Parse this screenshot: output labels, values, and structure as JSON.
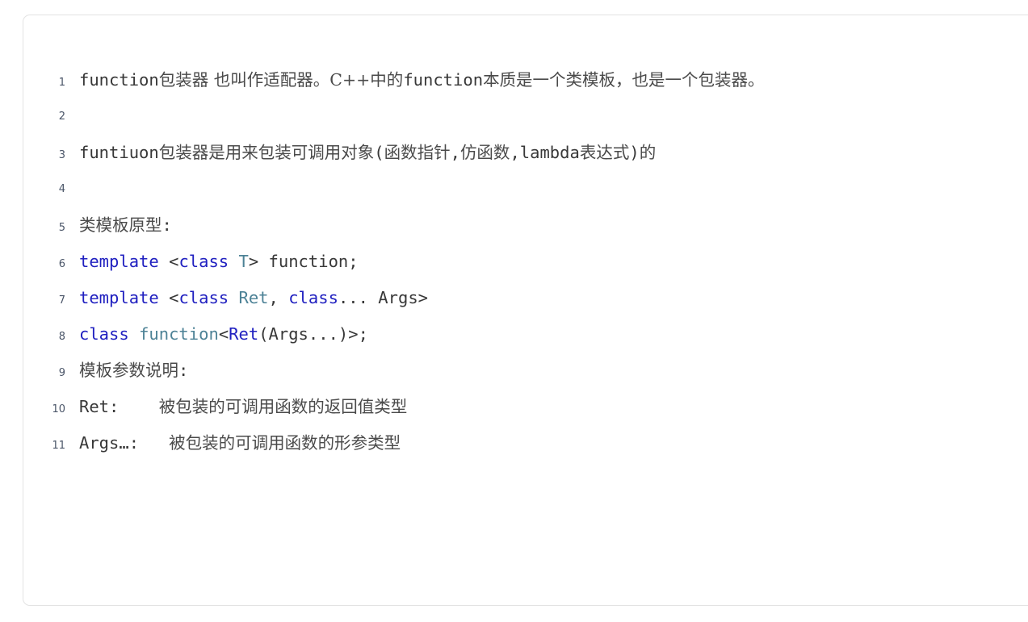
{
  "card": {
    "name": "code-block",
    "border_color": "#e3e3e3",
    "background": "#ffffff",
    "line_number_color": "#4a5568",
    "text_color": "#383838",
    "cjk_text_color": "#4a4a4a",
    "keyword_color": "#2020c0",
    "type_color": "#4d8296"
  },
  "lines": [
    {
      "number": "1",
      "text": "function包装器 也叫作适配器。C++中的function本质是一个类模板，也是一个包装器。",
      "segments": [
        {
          "text": "function",
          "kind": "plain"
        },
        {
          "text": "包装器 也叫作适配器。C++中的",
          "kind": "cjk"
        },
        {
          "text": "function",
          "kind": "plain"
        },
        {
          "text": "本质是一个类模板，也是一个包装器。",
          "kind": "cjk"
        }
      ]
    },
    {
      "number": "2",
      "text": "",
      "segments": []
    },
    {
      "number": "3",
      "text": "funtiuon包装器是用来包装可调用对象(函数指针,仿函数,lambda表达式)的",
      "segments": [
        {
          "text": "funtiuon",
          "kind": "plain"
        },
        {
          "text": "包装器是用来包装可调用对象",
          "kind": "cjk"
        },
        {
          "text": "(",
          "kind": "plain"
        },
        {
          "text": "函数指针",
          "kind": "cjk"
        },
        {
          "text": ",",
          "kind": "plain"
        },
        {
          "text": "仿函数",
          "kind": "cjk"
        },
        {
          "text": ",",
          "kind": "plain"
        },
        {
          "text": "lambda",
          "kind": "plain"
        },
        {
          "text": "表达式",
          "kind": "cjk"
        },
        {
          "text": ")",
          "kind": "plain"
        },
        {
          "text": "的",
          "kind": "cjk"
        }
      ]
    },
    {
      "number": "4",
      "text": "",
      "segments": []
    },
    {
      "number": "5",
      "text": "类模板原型:",
      "segments": [
        {
          "text": "类模板原型",
          "kind": "cjk"
        },
        {
          "text": ":",
          "kind": "plain"
        }
      ]
    },
    {
      "number": "6",
      "text": "template <class T> function;",
      "segments": [
        {
          "text": "template",
          "kind": "keyword"
        },
        {
          "text": " <",
          "kind": "plain"
        },
        {
          "text": "class",
          "kind": "keyword"
        },
        {
          "text": " ",
          "kind": "plain"
        },
        {
          "text": "T",
          "kind": "type"
        },
        {
          "text": "> function;",
          "kind": "plain"
        }
      ]
    },
    {
      "number": "7",
      "text": "template <class Ret, class... Args>",
      "segments": [
        {
          "text": "template",
          "kind": "keyword"
        },
        {
          "text": " <",
          "kind": "plain"
        },
        {
          "text": "class",
          "kind": "keyword"
        },
        {
          "text": " ",
          "kind": "plain"
        },
        {
          "text": "Ret",
          "kind": "type"
        },
        {
          "text": ", ",
          "kind": "plain"
        },
        {
          "text": "class",
          "kind": "keyword"
        },
        {
          "text": "... Args>",
          "kind": "plain"
        }
      ]
    },
    {
      "number": "8",
      "text": "class function<Ret(Args...)>;",
      "segments": [
        {
          "text": "class",
          "kind": "keyword"
        },
        {
          "text": " ",
          "kind": "plain"
        },
        {
          "text": "function",
          "kind": "type"
        },
        {
          "text": "<",
          "kind": "plain"
        },
        {
          "text": "Ret",
          "kind": "keyword"
        },
        {
          "text": "(Args...)>;",
          "kind": "plain"
        }
      ]
    },
    {
      "number": "9",
      "text": "模板参数说明:",
      "segments": [
        {
          "text": "模板参数说明",
          "kind": "cjk"
        },
        {
          "text": ":",
          "kind": "plain"
        }
      ]
    },
    {
      "number": "10",
      "text": "Ret:    被包装的可调用函数的返回值类型",
      "segments": [
        {
          "text": "Ret:    ",
          "kind": "plain"
        },
        {
          "text": "被包装的可调用函数的返回值类型",
          "kind": "cjk"
        }
      ]
    },
    {
      "number": "11",
      "text": "Args…:   被包装的可调用函数的形参类型",
      "segments": [
        {
          "text": "Args…:   ",
          "kind": "plain"
        },
        {
          "text": "被包装的可调用函数的形参类型",
          "kind": "cjk"
        }
      ]
    }
  ]
}
